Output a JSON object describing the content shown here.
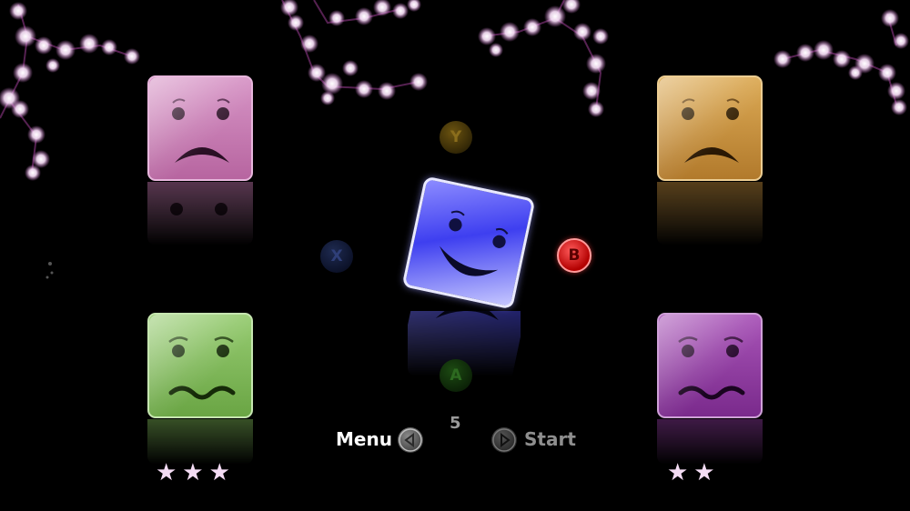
{
  "hud": {
    "menu_label": "Menu",
    "start_label": "Start",
    "counter": "5"
  },
  "buttons": {
    "y": "Y",
    "x": "X",
    "b": "B",
    "a": "A"
  },
  "faces": [
    {
      "id": "top-left",
      "color": "#c77ab0",
      "expression": "sad"
    },
    {
      "id": "top-right",
      "color": "#c8943e",
      "expression": "sad"
    },
    {
      "id": "center",
      "color": "#4a4cf0",
      "expression": "happy"
    },
    {
      "id": "bottom-left",
      "color": "#7fbb55",
      "expression": "wavy"
    },
    {
      "id": "bottom-right",
      "color": "#8a3a9a",
      "expression": "wavy"
    }
  ],
  "ratings": {
    "bottom_left": "★★★",
    "bottom_right": "★★"
  },
  "icons": [
    "left-arrow-icon",
    "right-arrow-icon",
    "star-icon",
    "cherry-blossom-icon"
  ]
}
